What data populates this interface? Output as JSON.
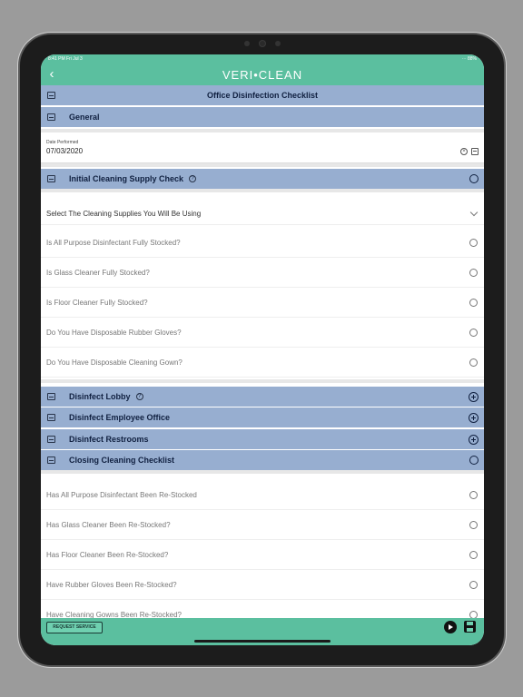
{
  "status_bar": {
    "time": "8:41 PM Fri Jul 3",
    "battery": "⋯ 88%"
  },
  "nav": {
    "brand": "VERI•CLEAN",
    "back_icon": "chevron-left-icon"
  },
  "form": {
    "title": "Office Disinfection Checklist"
  },
  "sections": {
    "general": "General",
    "initial": "Initial Cleaning Supply Check",
    "lobby": "Disinfect Lobby",
    "office": "Disinfect Employee Office",
    "restrooms": "Disinfect Restrooms",
    "closing": "Closing Cleaning Checklist"
  },
  "date_field": {
    "label": "Date Performed",
    "value": "07/03/2020"
  },
  "supplies_select": {
    "placeholder": "Select The Cleaning Supplies You Will Be Using"
  },
  "initial_questions": [
    "Is All Purpose Disinfectant Fully Stocked?",
    "Is Glass Cleaner Fully Stocked?",
    "Is Floor Cleaner Fully Stocked?",
    "Do You Have Disposable Rubber Gloves?",
    "Do You Have Disposable Cleaning Gown?"
  ],
  "closing_questions": [
    "Has All Purpose Disinfectant Been Re-Stocked",
    "Has Glass Cleaner Been Re-Stocked?",
    "Has Floor Cleaner Been Re-Stocked?",
    "Have Rubber Gloves Been Re-Stocked?",
    "Have Cleaning Gowns Been Re-Stocked?"
  ],
  "footer": {
    "request_label": "REQUEST SERVICE"
  },
  "colors": {
    "accent": "#5bbf9f",
    "section_header": "#97aed0",
    "text_dark": "#102040"
  }
}
